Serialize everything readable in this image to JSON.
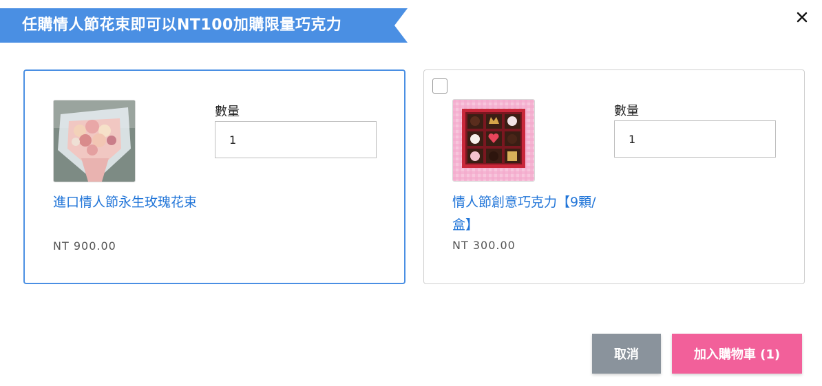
{
  "header": {
    "title": "任購情人節花束即可以NT100加購限量巧克力",
    "accent_color": "#4a8fe3"
  },
  "close_icon": "close-icon",
  "products": [
    {
      "name": "進口情人節永生玫瑰花束",
      "price": "NT 900.00",
      "quantity_label": "數量",
      "quantity_value": "1",
      "selected": true,
      "image_icon": "bouquet-image"
    },
    {
      "name": "情人節創意巧克力【9顆/盒】",
      "price": "NT 300.00",
      "quantity_label": "數量",
      "quantity_value": "1",
      "selected": false,
      "image_icon": "chocolate-box-image"
    }
  ],
  "footer": {
    "cancel_label": "取消",
    "add_to_cart_label": "加入購物車 (1)",
    "cancel_color": "#8a939c",
    "add_color": "#f2609a"
  }
}
